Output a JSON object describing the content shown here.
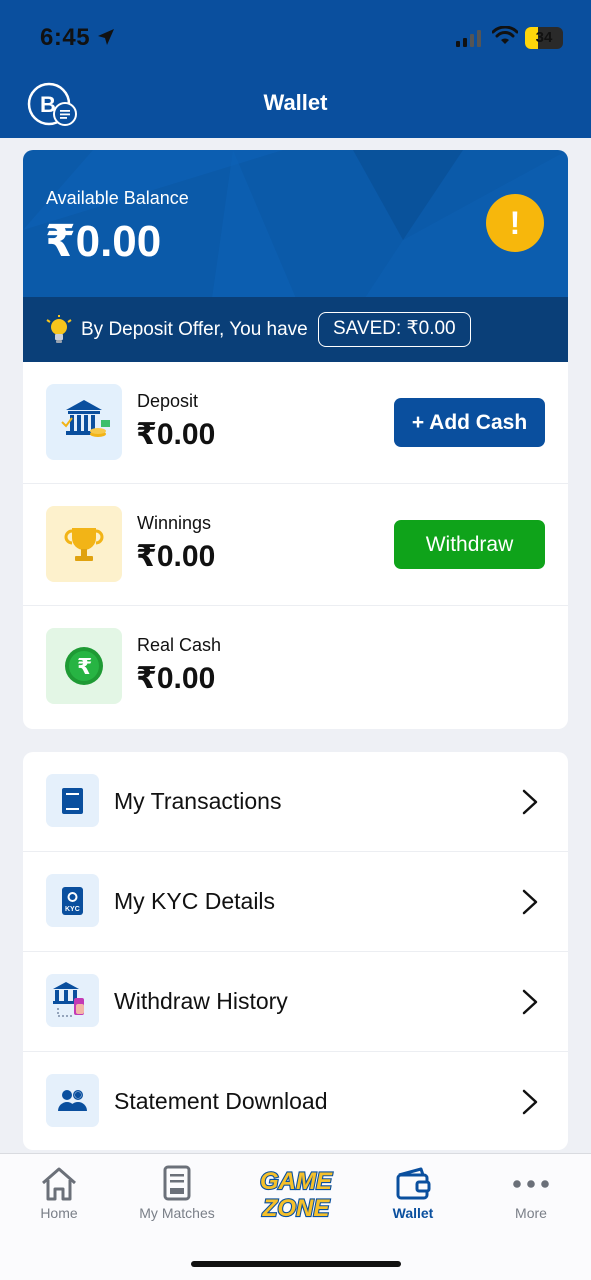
{
  "status_bar": {
    "time": "6:45",
    "battery": "34",
    "battery_level": 0.34
  },
  "header": {
    "title": "Wallet",
    "logo_icon": "app-logo-icon"
  },
  "balance": {
    "label": "Available Balance",
    "amount": "₹0.00",
    "alert_icon": "!",
    "offer_text": "By Deposit Offer, You have",
    "saved_chip": "SAVED: ₹0.00"
  },
  "cash": {
    "deposit": {
      "label": "Deposit",
      "amount": "₹0.00",
      "button": "+ Add Cash",
      "icon": "bank-icon"
    },
    "winnings": {
      "label": "Winnings",
      "amount": "₹0.00",
      "button": "Withdraw",
      "icon": "trophy-icon"
    },
    "real_cash": {
      "label": "Real Cash",
      "amount": "₹0.00",
      "icon": "rupee-coin-icon"
    }
  },
  "menu": [
    {
      "label": "My Transactions",
      "icon": "ledger-icon"
    },
    {
      "label": "My KYC Details",
      "icon": "kyc-icon"
    },
    {
      "label": "Withdraw History",
      "icon": "bank-transfer-icon"
    },
    {
      "label": "Statement Download",
      "icon": "users-icon"
    }
  ],
  "nav": {
    "home": "Home",
    "matches": "My Matches",
    "gamezone_line1": "GAME",
    "gamezone_line2": "ZONE",
    "wallet": "Wallet",
    "more": "More",
    "active": "wallet"
  },
  "colors": {
    "primary": "#0a4f9e",
    "card_blue": "#0b5aa9",
    "offer_strip": "#0a3f78",
    "withdraw_green": "#0fa31a",
    "alert_yellow": "#f7b70c"
  }
}
